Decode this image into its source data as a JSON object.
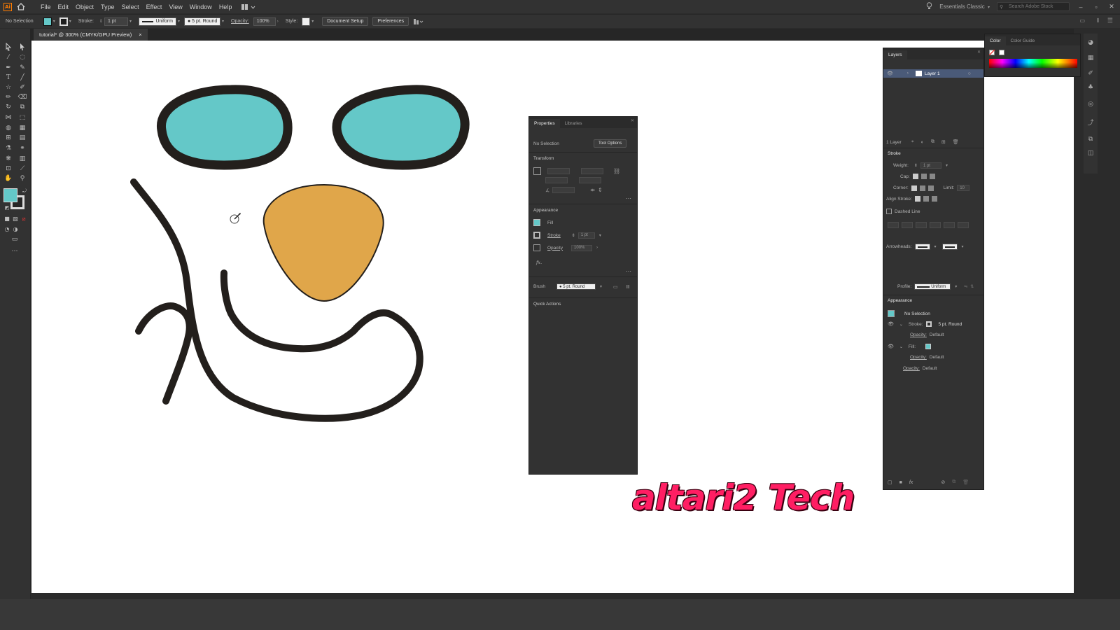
{
  "app": {
    "menu": [
      "File",
      "Edit",
      "Object",
      "Type",
      "Select",
      "Effect",
      "View",
      "Window",
      "Help"
    ],
    "workspace": "Essentials Classic",
    "search_placeholder": "Search Adobe Stock"
  },
  "control_bar": {
    "selection": "No Selection",
    "stroke_label": "Stroke:",
    "stroke_weight": "1 pt",
    "profile": "Uniform",
    "brush": "5 pt. Round",
    "opacity_label": "Opacity:",
    "opacity_value": "100%",
    "style_label": "Style:",
    "document_setup": "Document Setup",
    "preferences": "Preferences"
  },
  "document": {
    "tab_title": "tutorial* @ 300% (CMYK/GPU Preview)",
    "close": "×"
  },
  "properties_panel": {
    "tabs": [
      "Properties",
      "Libraries"
    ],
    "selection": "No Selection",
    "tool_options": "Tool Options",
    "transform": "Transform",
    "appearance": "Appearance",
    "fill": "Fill",
    "stroke": "Stroke",
    "stroke_value": "1 pt",
    "opacity": "Opacity",
    "opacity_value": "100%",
    "fx": "fx.",
    "brush_label": "Brush",
    "brush_value": "5 pt. Round",
    "quick_actions": "Quick Actions"
  },
  "layers_panel": {
    "tab": "Layers",
    "layer_name": "Layer 1",
    "footer_count": "1 Layer"
  },
  "stroke_panel": {
    "title": "Stroke",
    "weight_label": "Weight:",
    "weight_value": "1 pt",
    "cap_label": "Cap:",
    "corner_label": "Corner:",
    "limit_label": "Limit:",
    "limit_value": "10",
    "align_label": "Align Stroke:",
    "dashed_line": "Dashed Line",
    "arrowheads_label": "Arrowheads:",
    "profile_label": "Profile:",
    "profile_value": "Uniform"
  },
  "appearance_panel": {
    "title": "Appearance",
    "selection": "No Selection",
    "stroke_label": "Stroke:",
    "stroke_value": "5 pt. Round",
    "opacity_label": "Opacity:",
    "opacity_value": "Default",
    "fill_label": "Fill:"
  },
  "color_panel": {
    "tabs": [
      "Color",
      "Color Guide"
    ]
  },
  "watermark": "altari2 Tech",
  "colors": {
    "eye_fill": "#64c8c8",
    "nose_fill": "#e0a64a",
    "stroke": "#231f1c",
    "accent": "#ff1e63"
  }
}
